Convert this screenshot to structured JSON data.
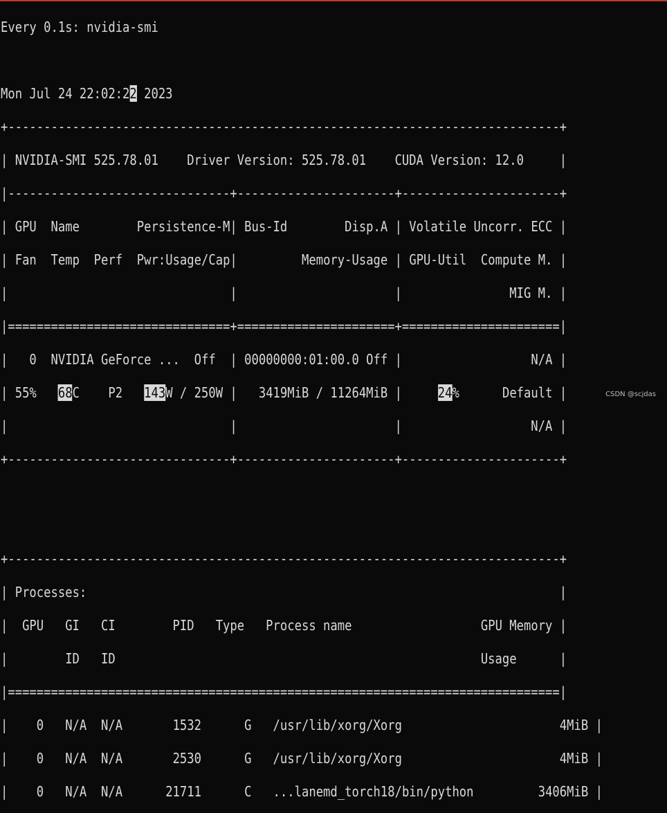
{
  "watch_header": {
    "interval": "Every 0.1s:",
    "command": "nvidia-smi"
  },
  "timestamp": {
    "before_cursor": "Mon Jul 24 22:02:2",
    "cursor_char": "2",
    "after_cursor": " 2023"
  },
  "smi_info": {
    "smi_version": "NVIDIA-SMI 525.78.01",
    "driver_version": "Driver Version: 525.78.01",
    "cuda_version": "CUDA Version: 12.0"
  },
  "gpu_table_headers": {
    "row1": [
      "GPU",
      "Name",
      "Persistence-M",
      "Bus-Id",
      "Disp.A",
      "Volatile Uncorr. ECC"
    ],
    "row2": [
      "Fan",
      "Temp",
      "Perf",
      "Pwr:Usage/Cap",
      "Memory-Usage",
      "GPU-Util",
      "Compute M."
    ],
    "row3": [
      "MIG M."
    ]
  },
  "gpu": {
    "index": "0",
    "name": "NVIDIA GeForce ...",
    "persistence": "Off",
    "bus_id": "00000000:01:00.0",
    "disp": "Off",
    "ecc": "N/A",
    "fan": "55%",
    "temp_value": "68",
    "temp_unit": "C",
    "perf": "P2",
    "power_usage": "143",
    "power_cap": "W / 250W",
    "memory_usage": "3419MiB / 11264MiB",
    "gpu_util_value": "24",
    "gpu_util_unit": "%",
    "compute_mode": "Default",
    "mig_mode": "N/A"
  },
  "process_table": {
    "title": "Processes:",
    "headers_row1": [
      "GPU",
      "GI",
      "CI",
      "PID",
      "Type",
      "Process name",
      "GPU Memory"
    ],
    "headers_row2": [
      "ID",
      "ID",
      "Usage"
    ],
    "rows": [
      {
        "gpu": "0",
        "gi": "N/A",
        "ci": "N/A",
        "pid": "1532",
        "type": "G",
        "name": "/usr/lib/xorg/Xorg",
        "mem": "4MiB"
      },
      {
        "gpu": "0",
        "gi": "N/A",
        "ci": "N/A",
        "pid": "2530",
        "type": "G",
        "name": "/usr/lib/xorg/Xorg",
        "mem": "4MiB"
      },
      {
        "gpu": "0",
        "gi": "N/A",
        "ci": "N/A",
        "pid": "21711",
        "type": "C",
        "name": "...lanemd_torch18/bin/python",
        "mem": "3406MiB"
      }
    ]
  },
  "watermark": "CSDN @scjdas",
  "colors": {
    "background": "#0a0a0a",
    "foreground": "#d9d9d9",
    "top_rule": "#c0392b"
  }
}
